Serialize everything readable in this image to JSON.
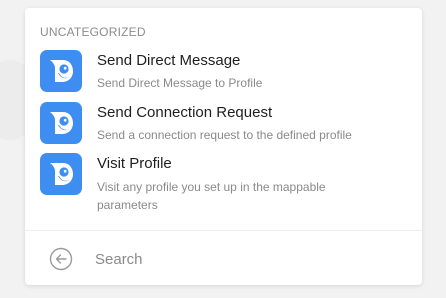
{
  "section": {
    "header": "UNCATEGORIZED"
  },
  "colors": {
    "icon_bg": "#3d8ef0",
    "panel_bg": "#ffffff"
  },
  "modules": [
    {
      "title": "Send Direct Message",
      "description": "Send Direct Message to Profile",
      "icon": "app-bird-logo-icon"
    },
    {
      "title": "Send Connection Request",
      "description": "Send a connection request to the defined profile",
      "icon": "app-bird-logo-icon"
    },
    {
      "title": "Visit Profile",
      "description": "Visit any profile you set up in the mappable parameters",
      "icon": "app-bird-logo-icon"
    }
  ],
  "footer": {
    "back_icon": "back-arrow-circle-icon",
    "search_placeholder": "Search"
  }
}
